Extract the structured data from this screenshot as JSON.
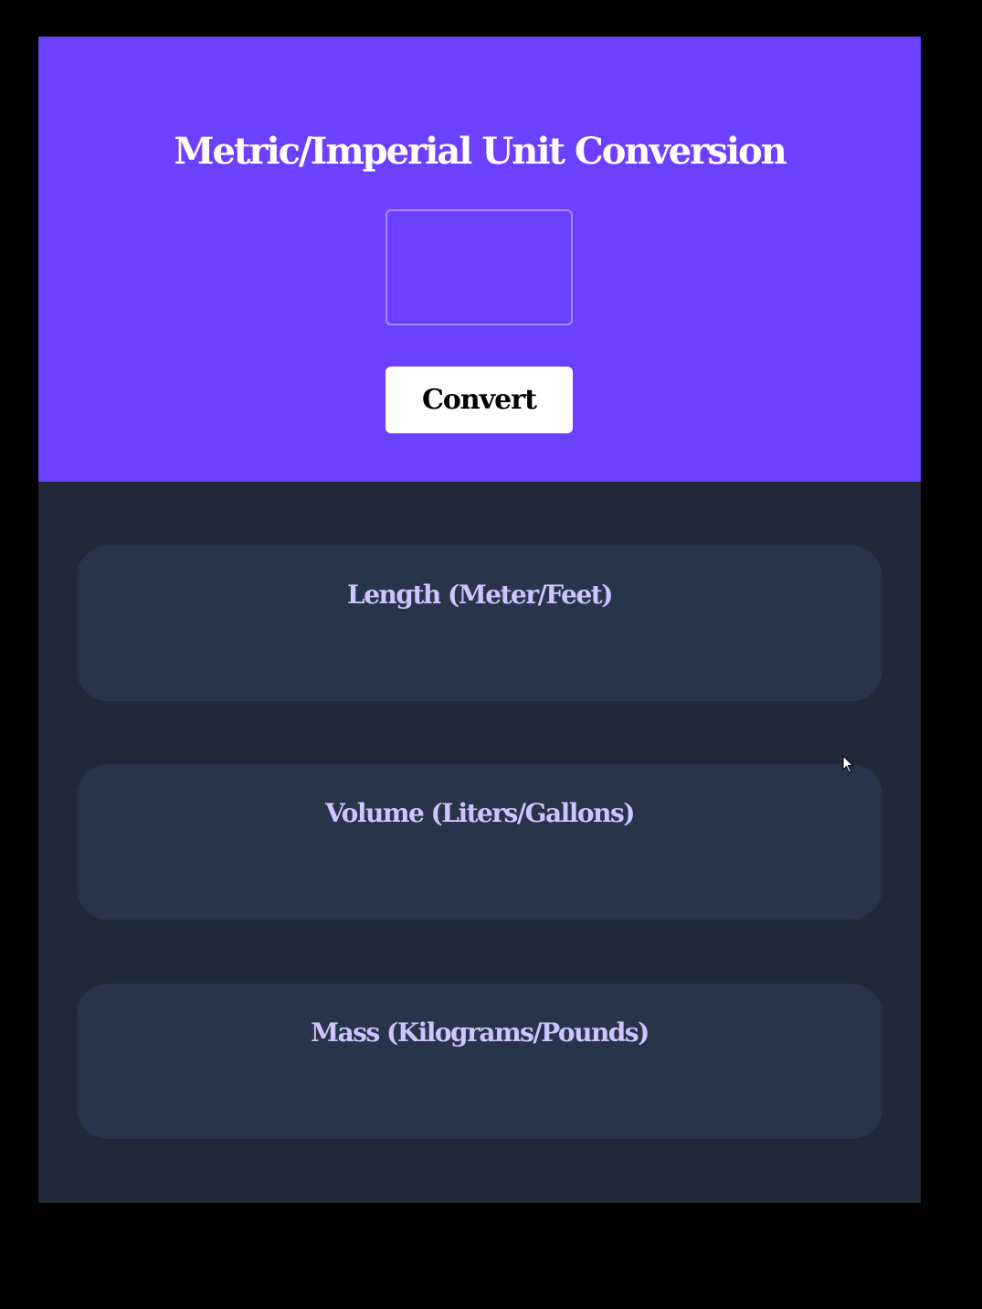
{
  "header": {
    "title": "Metric/Imperial Unit Conversion",
    "input_value": "",
    "convert_label": "Convert"
  },
  "cards": [
    {
      "title": "Length (Meter/Feet)",
      "result": ""
    },
    {
      "title": "Volume (Liters/Gallons)",
      "result": ""
    },
    {
      "title": "Mass (Kilograms/Pounds)",
      "result": ""
    }
  ],
  "colors": {
    "header_bg": "#6d40ff",
    "body_bg": "#1f2937",
    "card_bg": "#273449",
    "card_title": "#cdc5ff",
    "input_border": "#a98cff",
    "button_bg": "#ffffff"
  },
  "icons": {
    "cursor": "mouse-pointer-icon"
  }
}
